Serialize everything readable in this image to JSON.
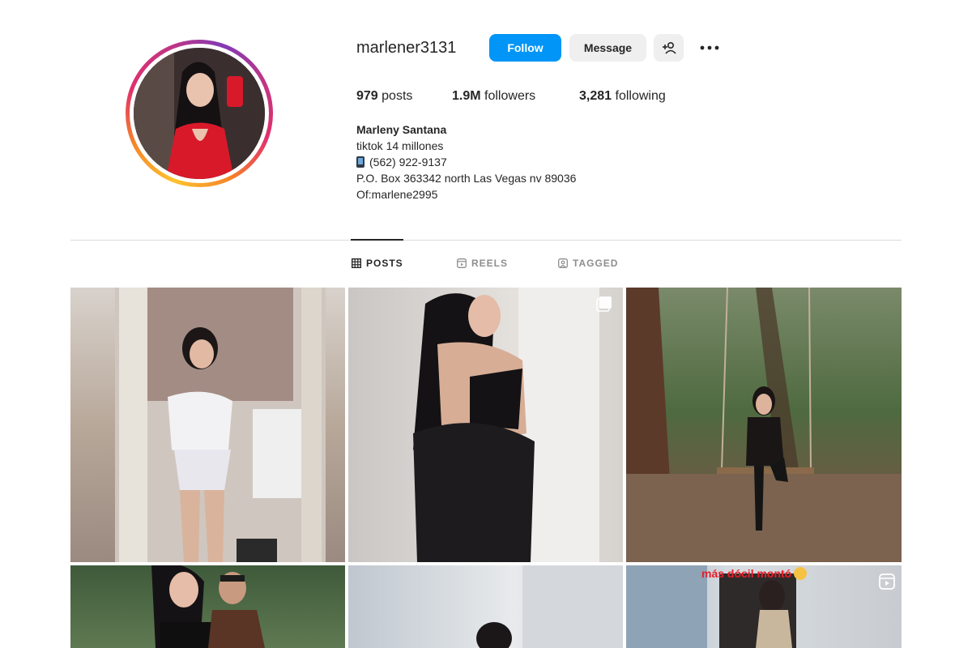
{
  "profile": {
    "username": "marlener3131",
    "buttons": {
      "follow": "Follow",
      "message": "Message"
    },
    "stats": {
      "posts_count": "979",
      "posts_label": "posts",
      "followers_count": "1.9M",
      "followers_label": "followers",
      "following_count": "3,281",
      "following_label": "following"
    },
    "bio": {
      "name": "Marleny Santana",
      "line1": "tiktok 14 millones",
      "phone": "(562) 922-9137",
      "address": "P.O. Box 363342 north Las Vegas nv 89036",
      "of": "Of:marlene2995"
    },
    "avatar_ring_colors": [
      "#fdc22d",
      "#f58529",
      "#e1306c",
      "#c13584",
      "#833ab4"
    ]
  },
  "tabs": [
    {
      "label": "POSTS",
      "icon": "grid-icon",
      "active": true
    },
    {
      "label": "REELS",
      "icon": "reels-icon",
      "active": false
    },
    {
      "label": "TAGGED",
      "icon": "tagged-icon",
      "active": false
    }
  ],
  "posts": {
    "overlay_caption": "más dócil montó",
    "icons": {
      "carousel": "carousel-icon",
      "reel": "reel-icon"
    }
  },
  "colors": {
    "accent": "#0095f6",
    "text": "#262626",
    "muted": "#8e8e8e",
    "divider": "#dbdbdb"
  }
}
